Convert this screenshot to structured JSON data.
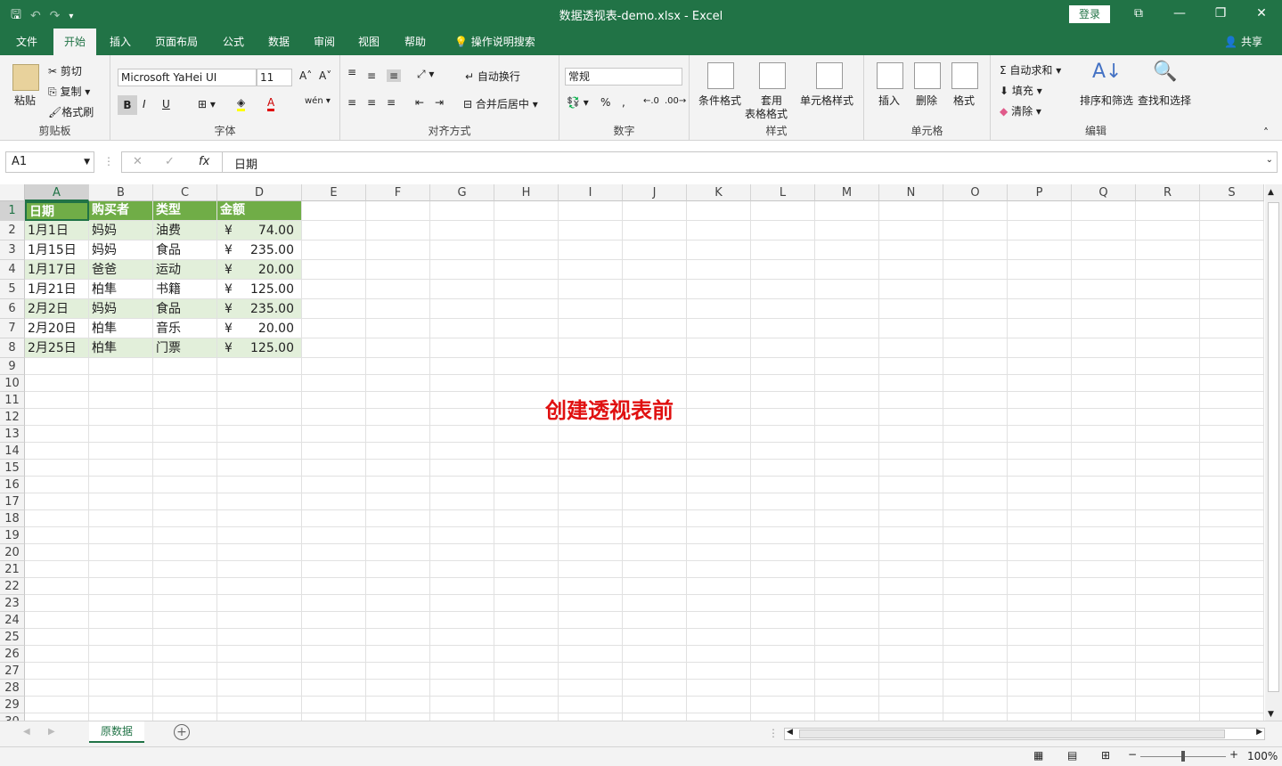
{
  "titlebar": {
    "title": "数据透视表-demo.xlsx  -  Excel",
    "login": "登录",
    "qat_icons": [
      "save-icon",
      "undo-icon",
      "redo-icon",
      "customize-icon"
    ]
  },
  "menu": {
    "tabs": [
      "文件",
      "开始",
      "插入",
      "页面布局",
      "公式",
      "数据",
      "审阅",
      "视图",
      "帮助"
    ],
    "search": "操作说明搜索",
    "share": "共享"
  },
  "ribbon": {
    "clipboard": {
      "paste": "粘贴",
      "cut": "剪切",
      "copy": "复制",
      "format_painter": "格式刷",
      "label": "剪贴板"
    },
    "font": {
      "family": "Microsoft YaHei UI",
      "size": "11",
      "bold": "B",
      "italic": "I",
      "underline": "U",
      "label": "字体"
    },
    "alignment": {
      "wrap": "自动换行",
      "merge": "合并后居中",
      "label": "对齐方式"
    },
    "number": {
      "format": "常规",
      "percent": "%",
      "comma": ",",
      "label": "数字"
    },
    "styles": {
      "conditional": "条件格式",
      "table_l1": "套用",
      "table_l2": "表格格式",
      "cell_styles": "单元格样式",
      "label": "样式"
    },
    "cells": {
      "insert": "插入",
      "delete": "删除",
      "format": "格式",
      "label": "单元格"
    },
    "editing": {
      "autosum": "自动求和",
      "fill": "填充",
      "clear": "清除",
      "sort": "排序和筛选",
      "find": "查找和选择",
      "label": "编辑"
    }
  },
  "formula": {
    "namebox": "A1",
    "fx": "fx",
    "content": "日期"
  },
  "columns": [
    "A",
    "B",
    "C",
    "D",
    "E",
    "F",
    "G",
    "H",
    "I",
    "J",
    "K",
    "L",
    "M",
    "N",
    "O",
    "P",
    "Q",
    "R",
    "S"
  ],
  "rows": [
    "1",
    "2",
    "3",
    "4",
    "5",
    "6",
    "7",
    "8",
    "9",
    "10",
    "11",
    "12",
    "13",
    "14",
    "15",
    "16",
    "17",
    "18",
    "19",
    "20",
    "21",
    "22",
    "23",
    "24",
    "25",
    "26",
    "27",
    "28",
    "29",
    "30"
  ],
  "table": {
    "headers": [
      "日期",
      "购买者",
      "类型",
      "金额"
    ],
    "currency": "¥",
    "rows": [
      [
        "1月1日",
        "妈妈",
        "油费",
        "74.00"
      ],
      [
        "1月15日",
        "妈妈",
        "食品",
        "235.00"
      ],
      [
        "1月17日",
        "爸爸",
        "运动",
        "20.00"
      ],
      [
        "1月21日",
        "柏隼",
        "书籍",
        "125.00"
      ],
      [
        "2月2日",
        "妈妈",
        "食品",
        "235.00"
      ],
      [
        "2月20日",
        "柏隼",
        "音乐",
        "20.00"
      ],
      [
        "2月25日",
        "柏隼",
        "门票",
        "125.00"
      ]
    ]
  },
  "note": "创建透视表前",
  "sheet": {
    "name": "原数据"
  },
  "status": {
    "zoom": "100%"
  },
  "colors": {
    "accent": "#217346",
    "header_fill": "#70ad47",
    "band_fill": "#e2efda",
    "note": "#e01010"
  }
}
